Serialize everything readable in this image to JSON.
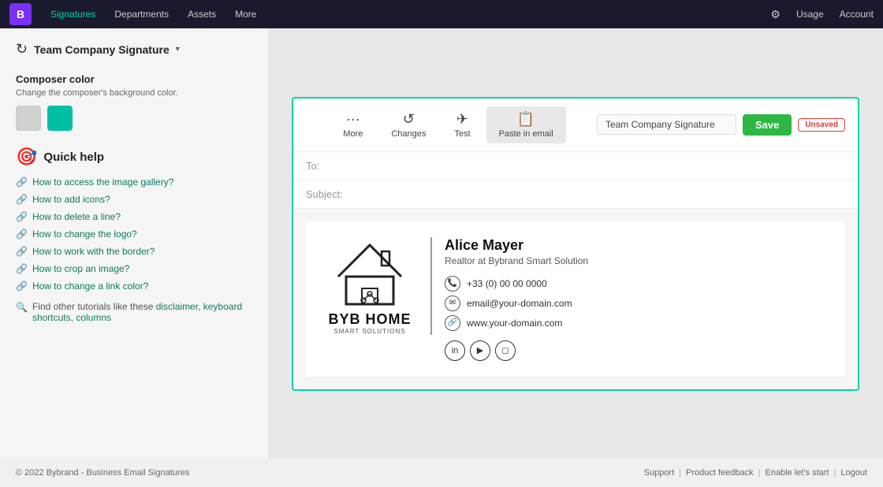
{
  "nav": {
    "logo": "B",
    "items": [
      {
        "label": "Signatures",
        "active": true
      },
      {
        "label": "Departments",
        "active": false
      },
      {
        "label": "Assets",
        "active": false
      },
      {
        "label": "More",
        "active": false
      }
    ],
    "right_items": [
      {
        "label": "⚙",
        "name": "settings-icon"
      },
      {
        "label": "Usage",
        "name": "usage-nav"
      },
      {
        "label": "Account",
        "name": "account-nav"
      }
    ]
  },
  "sidebar": {
    "signature_name": "Team Company Signature",
    "dropdown_arrow": "▾",
    "composer_color": {
      "label": "Composer color",
      "description": "Change the composer's background color.",
      "swatches": [
        "gray",
        "teal"
      ]
    },
    "quick_help": {
      "title": "Quick help",
      "links": [
        "How to access the image gallery?",
        "How to add icons?",
        "How to delete a line?",
        "How to change the logo?",
        "How to work with the border?",
        "How to crop an image?",
        "How to change a link color?"
      ],
      "find_more": "Find other tutorials like these",
      "find_more_links": [
        "disclaimer",
        "keyboard shortcuts",
        "columns"
      ]
    }
  },
  "toolbar": {
    "buttons": [
      {
        "label": "More",
        "icon": "···"
      },
      {
        "label": "Changes",
        "icon": "↺"
      },
      {
        "label": "Test",
        "icon": "✈"
      },
      {
        "label": "Paste in email",
        "icon": "📋"
      }
    ],
    "active_button": "Paste in email",
    "signature_input_value": "Team Company Signature",
    "save_label": "Save",
    "unsaved_label": "Unsaved"
  },
  "email": {
    "to_placeholder": "To:",
    "subject_placeholder": "Subject:"
  },
  "signature": {
    "person_name": "Alice Mayer",
    "person_title": "Realtor at Bybrand Smart Solution",
    "phone": "+33 (0) 00 00 0000",
    "email": "email@your-domain.com",
    "website": "www.your-domain.com",
    "company_name": "BYB HOME",
    "company_sub": "SMART SOLUTIONS",
    "social": [
      {
        "name": "linkedin",
        "icon": "in"
      },
      {
        "name": "youtube",
        "icon": "▶"
      },
      {
        "name": "instagram",
        "icon": "◻"
      }
    ]
  },
  "footer": {
    "copyright": "© 2022 Bybrand - Business Email Signatures",
    "links": [
      "Support",
      "Product feedback",
      "Enable let's start",
      "Logout"
    ]
  }
}
